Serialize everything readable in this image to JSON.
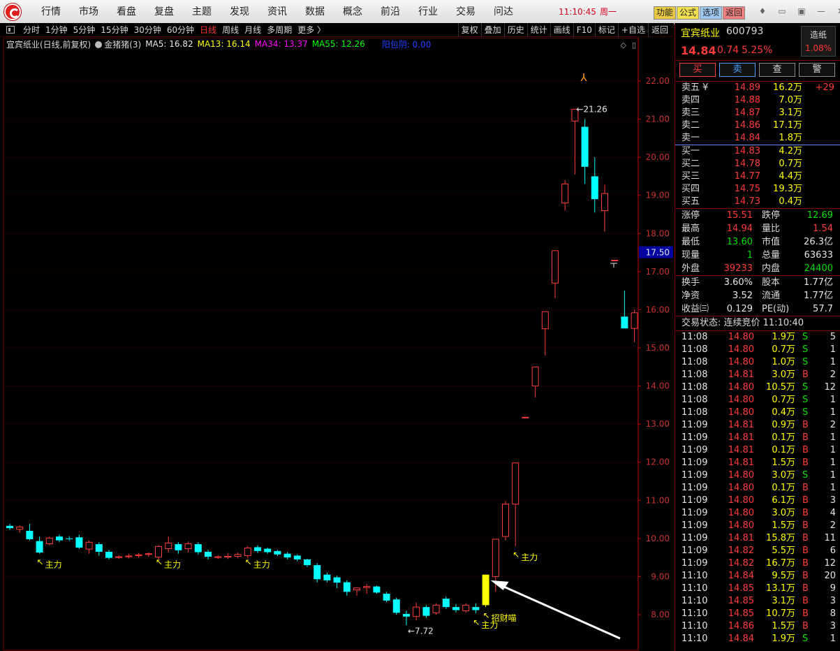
{
  "menu": {
    "items": [
      "行情",
      "市场",
      "看盘",
      "复盘",
      "主题",
      "发现",
      "资讯",
      "数据",
      "概念",
      "前沿",
      "行业",
      "交易",
      "问达"
    ],
    "clock": "11:10:45",
    "weekday": "周一",
    "tool_buttons": [
      {
        "label": "功能",
        "bg": "#e8c840"
      },
      {
        "label": "公式",
        "bg": "#f0e050"
      },
      {
        "label": "选项",
        "bg": "#9ec8f0"
      },
      {
        "label": "返回",
        "bg": "#f08080"
      }
    ]
  },
  "periods": {
    "items": [
      "分时",
      "1分钟",
      "5分钟",
      "15分钟",
      "30分钟",
      "60分钟",
      "日线",
      "周线",
      "月线",
      "多周期",
      "更多 〉"
    ],
    "active": "日线"
  },
  "chart_tools": [
    "复权",
    "叠加",
    "历史",
    "统计",
    "画线",
    "F10",
    "标记",
    "+自选",
    "返回"
  ],
  "indicator": {
    "title": "宜宾纸业(日线,前复权)",
    "indicator_name": "金猪猪(3)",
    "ma5": "MA5: 16.82",
    "ma13": "MA13: 16.14",
    "ma34": "MA34: 13.37",
    "ma55": "MA55: 12.26",
    "extra": "阳包阴: 0.00",
    "colors": {
      "ma5": "#e6e6e6",
      "ma13": "#ffff00",
      "ma34": "#ff00ff",
      "ma55": "#00ff00",
      "extra": "#2040ff"
    }
  },
  "chart_data": {
    "type": "candlestick",
    "y_ticks": [
      "22.00",
      "21.00",
      "20.00",
      "19.00",
      "18.00",
      "17.00",
      "16.00",
      "15.00",
      "14.00",
      "13.00",
      "12.00",
      "11.00",
      "10.00",
      "9.00",
      "8.00"
    ],
    "ylim": [
      7.5,
      22.5
    ],
    "current_price_tag": "17.50",
    "candles": [
      {
        "o": 10.33,
        "c": 10.27,
        "h": 10.38,
        "l": 10.22
      },
      {
        "o": 10.24,
        "c": 10.3,
        "h": 10.35,
        "l": 10.15
      },
      {
        "o": 10.2,
        "c": 9.98,
        "h": 10.38,
        "l": 9.95
      },
      {
        "o": 9.93,
        "c": 9.63,
        "h": 10.05,
        "l": 9.6
      },
      {
        "o": 9.86,
        "c": 10.01,
        "h": 10.05,
        "l": 9.82
      },
      {
        "o": 10.05,
        "c": 9.95,
        "h": 10.1,
        "l": 9.9
      },
      {
        "o": 10.0,
        "c": 9.99,
        "h": 10.06,
        "l": 9.94
      },
      {
        "o": 10.03,
        "c": 9.76,
        "h": 10.1,
        "l": 9.73
      },
      {
        "o": 9.72,
        "c": 9.9,
        "h": 9.95,
        "l": 9.6
      },
      {
        "o": 9.85,
        "c": 9.65,
        "h": 9.9,
        "l": 9.55
      },
      {
        "o": 9.65,
        "c": 9.49,
        "h": 9.7,
        "l": 9.45
      },
      {
        "o": 9.5,
        "c": 9.52,
        "h": 9.56,
        "l": 9.46
      },
      {
        "o": 9.52,
        "c": 9.54,
        "h": 9.6,
        "l": 9.48
      },
      {
        "o": 9.55,
        "c": 9.57,
        "h": 9.62,
        "l": 9.5
      },
      {
        "o": 9.58,
        "c": 9.6,
        "h": 9.63,
        "l": 9.52
      },
      {
        "o": 9.51,
        "c": 9.79,
        "h": 9.82,
        "l": 9.45
      },
      {
        "o": 9.73,
        "c": 9.88,
        "h": 10.05,
        "l": 9.63
      },
      {
        "o": 9.85,
        "c": 9.69,
        "h": 9.9,
        "l": 9.6
      },
      {
        "o": 9.73,
        "c": 9.86,
        "h": 9.92,
        "l": 9.63
      },
      {
        "o": 9.85,
        "c": 9.64,
        "h": 9.9,
        "l": 9.58
      },
      {
        "o": 9.65,
        "c": 9.52,
        "h": 9.7,
        "l": 9.45
      },
      {
        "o": 9.5,
        "c": 9.52,
        "h": 9.56,
        "l": 9.46
      },
      {
        "o": 9.52,
        "c": 9.53,
        "h": 9.62,
        "l": 9.46
      },
      {
        "o": 9.53,
        "c": 9.58,
        "h": 9.63,
        "l": 9.48
      },
      {
        "o": 9.55,
        "c": 9.75,
        "h": 9.8,
        "l": 9.48
      },
      {
        "o": 9.77,
        "c": 9.67,
        "h": 9.82,
        "l": 9.62
      },
      {
        "o": 9.73,
        "c": 9.64,
        "h": 9.76,
        "l": 9.6
      },
      {
        "o": 9.67,
        "c": 9.58,
        "h": 9.7,
        "l": 9.54
      },
      {
        "o": 9.6,
        "c": 9.5,
        "h": 9.64,
        "l": 9.45
      },
      {
        "o": 9.55,
        "c": 9.45,
        "h": 9.58,
        "l": 9.4
      },
      {
        "o": 9.45,
        "c": 9.3,
        "h": 9.47,
        "l": 9.25
      },
      {
        "o": 9.3,
        "c": 8.93,
        "h": 9.35,
        "l": 8.85
      },
      {
        "o": 9.05,
        "c": 8.9,
        "h": 9.1,
        "l": 8.85
      },
      {
        "o": 8.98,
        "c": 8.84,
        "h": 9.03,
        "l": 8.7
      },
      {
        "o": 8.85,
        "c": 8.6,
        "h": 8.9,
        "l": 8.5
      },
      {
        "o": 8.65,
        "c": 8.7,
        "h": 8.72,
        "l": 8.5
      },
      {
        "o": 8.71,
        "c": 8.74,
        "h": 8.8,
        "l": 8.55
      },
      {
        "o": 8.74,
        "c": 8.58,
        "h": 8.76,
        "l": 8.55
      },
      {
        "o": 8.55,
        "c": 8.37,
        "h": 8.6,
        "l": 8.33
      },
      {
        "o": 8.4,
        "c": 8.05,
        "h": 8.45,
        "l": 8.0
      },
      {
        "o": 8.02,
        "c": 7.95,
        "h": 8.1,
        "l": 7.72
      },
      {
        "o": 7.95,
        "c": 8.2,
        "h": 8.32,
        "l": 7.85
      },
      {
        "o": 8.2,
        "c": 7.97,
        "h": 8.25,
        "l": 7.92
      },
      {
        "o": 8.05,
        "c": 8.25,
        "h": 8.3,
        "l": 8.0
      },
      {
        "o": 8.42,
        "c": 8.2,
        "h": 8.47,
        "l": 8.15
      },
      {
        "o": 8.2,
        "c": 8.12,
        "h": 8.28,
        "l": 8.06
      },
      {
        "o": 8.1,
        "c": 8.25,
        "h": 8.3,
        "l": 8.05
      },
      {
        "o": 8.2,
        "c": 8.12,
        "h": 8.3,
        "l": 8.04
      },
      {
        "o": 8.25,
        "c": 9.05,
        "h": 9.05,
        "l": 8.2
      },
      {
        "o": 9.0,
        "c": 9.98,
        "h": 9.98,
        "l": 8.6
      },
      {
        "o": 10.05,
        "c": 10.9,
        "h": 10.98,
        "l": 9.95
      },
      {
        "o": 10.9,
        "c": 11.98,
        "h": 11.98,
        "l": 9.8
      },
      {
        "o": 13.18,
        "c": 13.18,
        "h": 13.18,
        "l": 13.18
      },
      {
        "o": 14.0,
        "c": 14.5,
        "h": 14.5,
        "l": 13.7
      },
      {
        "o": 15.5,
        "c": 15.95,
        "h": 15.95,
        "l": 14.8
      },
      {
        "o": 16.7,
        "c": 17.55,
        "h": 17.55,
        "l": 16.3
      },
      {
        "o": 18.8,
        "c": 19.3,
        "h": 19.4,
        "l": 18.6
      },
      {
        "o": 20.95,
        "c": 21.26,
        "h": 21.26,
        "l": 19.55
      },
      {
        "o": 20.8,
        "c": 19.75,
        "h": 21.0,
        "l": 19.3
      },
      {
        "o": 19.5,
        "c": 18.9,
        "h": 20.0,
        "l": 18.55
      },
      {
        "o": 18.6,
        "c": 19.05,
        "h": 19.28,
        "l": 18.05
      },
      {
        "o": 17.3,
        "c": 17.3,
        "h": 17.3,
        "l": 17.3
      },
      {
        "o": 15.82,
        "c": 15.51,
        "h": 16.5,
        "l": 15.51
      },
      {
        "o": 15.51,
        "c": 15.92,
        "h": 16.0,
        "l": 15.15
      }
    ],
    "highlight_index": 48,
    "labels": [
      {
        "text": "主力",
        "i": 3,
        "price": 9.6
      },
      {
        "text": "主力",
        "i": 15,
        "price": 9.6
      },
      {
        "text": "主力",
        "i": 24,
        "price": 9.6
      },
      {
        "text": "主力",
        "i": 47,
        "price": 8.02
      },
      {
        "text": "招财喵",
        "i": 48,
        "price": 8.2
      },
      {
        "text": "主力",
        "i": 51,
        "price": 9.8
      }
    ],
    "min_marker": {
      "text": "7.72",
      "i": 40,
      "price": 7.72
    },
    "max_marker": {
      "text": "21.26",
      "i": 57,
      "price": 21.26
    },
    "colors": {
      "up": "#ff3c3c",
      "down": "#00ffff",
      "grid": "#5a0000",
      "axis": "#c00000",
      "highlight": "#ffff00"
    }
  },
  "quote": {
    "name": "宜宾纸业",
    "code": "600793",
    "price": "14.84",
    "change": "0.74",
    "change_pct": "5.25%",
    "badge_title": "造纸",
    "badge_value": "1.08%",
    "buttons": [
      {
        "label": "买",
        "color": "#ff3a3a",
        "border": "#ff3a3a"
      },
      {
        "label": "卖",
        "color": "#4aa0ff",
        "border": "#4aa0ff"
      },
      {
        "label": "查",
        "color": "#d8d8d8",
        "border": "#888"
      },
      {
        "label": "警",
        "color": "#d8d8d8",
        "border": "#888"
      }
    ]
  },
  "orderbook": {
    "sells": [
      {
        "label": "卖五 ¥",
        "price": "14.89",
        "vol": "16.2万",
        "extra": "+29"
      },
      {
        "label": "卖四",
        "price": "14.88",
        "vol": "7.0万",
        "extra": ""
      },
      {
        "label": "卖三",
        "price": "14.87",
        "vol": "3.1万",
        "extra": ""
      },
      {
        "label": "卖二",
        "price": "14.86",
        "vol": "17.1万",
        "extra": ""
      },
      {
        "label": "卖一",
        "price": "14.84",
        "vol": "1.8万",
        "extra": ""
      }
    ],
    "buys": [
      {
        "label": "买一",
        "price": "14.83",
        "vol": "4.2万",
        "extra": ""
      },
      {
        "label": "买二",
        "price": "14.78",
        "vol": "0.7万",
        "extra": ""
      },
      {
        "label": "买三",
        "price": "14.77",
        "vol": "4.4万",
        "extra": ""
      },
      {
        "label": "买四",
        "price": "14.75",
        "vol": "19.3万",
        "extra": ""
      },
      {
        "label": "买五",
        "price": "14.73",
        "vol": "0.4万",
        "extra": ""
      }
    ]
  },
  "stats": [
    [
      {
        "l": "涨停",
        "v": "15.51",
        "c": "red"
      },
      {
        "l": "跌停",
        "v": "12.69",
        "c": "green"
      }
    ],
    [
      {
        "l": "最高",
        "v": "14.94",
        "c": "red"
      },
      {
        "l": "量比",
        "v": "1.54",
        "c": "red"
      }
    ],
    [
      {
        "l": "最低",
        "v": "13.60",
        "c": "green"
      },
      {
        "l": "市值",
        "v": "26.3亿",
        "c": "white"
      }
    ],
    [
      {
        "l": "现量",
        "v": "1",
        "c": "green"
      },
      {
        "l": "总量",
        "v": "63633",
        "c": "white"
      }
    ],
    [
      {
        "l": "外盘",
        "v": "39233",
        "c": "red"
      },
      {
        "l": "内盘",
        "v": "24400",
        "c": "green"
      }
    ]
  ],
  "stats2": [
    [
      {
        "l": "换手",
        "v": "3.60%",
        "c": "white"
      },
      {
        "l": "股本",
        "v": "1.77亿",
        "c": "white"
      }
    ],
    [
      {
        "l": "净资",
        "v": "3.52",
        "c": "white"
      },
      {
        "l": "流通",
        "v": "1.77亿",
        "c": "white"
      }
    ],
    [
      {
        "l": "收益㈢",
        "v": "0.129",
        "c": "white"
      },
      {
        "l": "PE(动)",
        "v": "57.7",
        "c": "white"
      }
    ]
  ],
  "status_line": "交易状态: 连续竞价 11:10:40",
  "ticks": [
    {
      "t": "11:08",
      "p": "14.80",
      "v": "1.9万",
      "s": "S",
      "n": "5"
    },
    {
      "t": "11:08",
      "p": "14.80",
      "v": "0.7万",
      "s": "S",
      "n": "1"
    },
    {
      "t": "11:08",
      "p": "14.80",
      "v": "1.0万",
      "s": "S",
      "n": "1"
    },
    {
      "t": "11:08",
      "p": "14.81",
      "v": "3.0万",
      "s": "B",
      "n": "2"
    },
    {
      "t": "11:08",
      "p": "14.80",
      "v": "10.5万",
      "s": "S",
      "n": "12"
    },
    {
      "t": "11:08",
      "p": "14.80",
      "v": "0.7万",
      "s": "S",
      "n": "1"
    },
    {
      "t": "11:08",
      "p": "14.80",
      "v": "0.4万",
      "s": "S",
      "n": "1"
    },
    {
      "t": "11:09",
      "p": "14.81",
      "v": "0.9万",
      "s": "B",
      "n": "2"
    },
    {
      "t": "11:09",
      "p": "14.81",
      "v": "0.1万",
      "s": "B",
      "n": "1"
    },
    {
      "t": "11:09",
      "p": "14.81",
      "v": "0.1万",
      "s": "B",
      "n": "1"
    },
    {
      "t": "11:09",
      "p": "14.81",
      "v": "1.5万",
      "s": "B",
      "n": "1"
    },
    {
      "t": "11:09",
      "p": "14.80",
      "v": "3.0万",
      "s": "S",
      "n": "1"
    },
    {
      "t": "11:09",
      "p": "14.80",
      "v": "0.1万",
      "s": "B",
      "n": "1"
    },
    {
      "t": "11:09",
      "p": "14.80",
      "v": "6.1万",
      "s": "B",
      "n": "3"
    },
    {
      "t": "11:09",
      "p": "14.80",
      "v": "3.0万",
      "s": "B",
      "n": "4"
    },
    {
      "t": "11:09",
      "p": "14.80",
      "v": "1.5万",
      "s": "B",
      "n": "2"
    },
    {
      "t": "11:09",
      "p": "14.81",
      "v": "15.8万",
      "s": "B",
      "n": "11"
    },
    {
      "t": "11:09",
      "p": "14.82",
      "v": "5.5万",
      "s": "B",
      "n": "6"
    },
    {
      "t": "11:09",
      "p": "14.82",
      "v": "16.7万",
      "s": "B",
      "n": "12"
    },
    {
      "t": "11:10",
      "p": "14.84",
      "v": "9.5万",
      "s": "B",
      "n": "20"
    },
    {
      "t": "11:10",
      "p": "14.85",
      "v": "13.1万",
      "s": "B",
      "n": "9"
    },
    {
      "t": "11:10",
      "p": "14.85",
      "v": "3.1万",
      "s": "B",
      "n": "3"
    },
    {
      "t": "11:10",
      "p": "14.85",
      "v": "10.7万",
      "s": "B",
      "n": "8"
    },
    {
      "t": "11:10",
      "p": "14.86",
      "v": "1.5万",
      "s": "B",
      "n": "3"
    },
    {
      "t": "11:10",
      "p": "14.84",
      "v": "1.9万",
      "s": "S",
      "n": "1"
    }
  ]
}
